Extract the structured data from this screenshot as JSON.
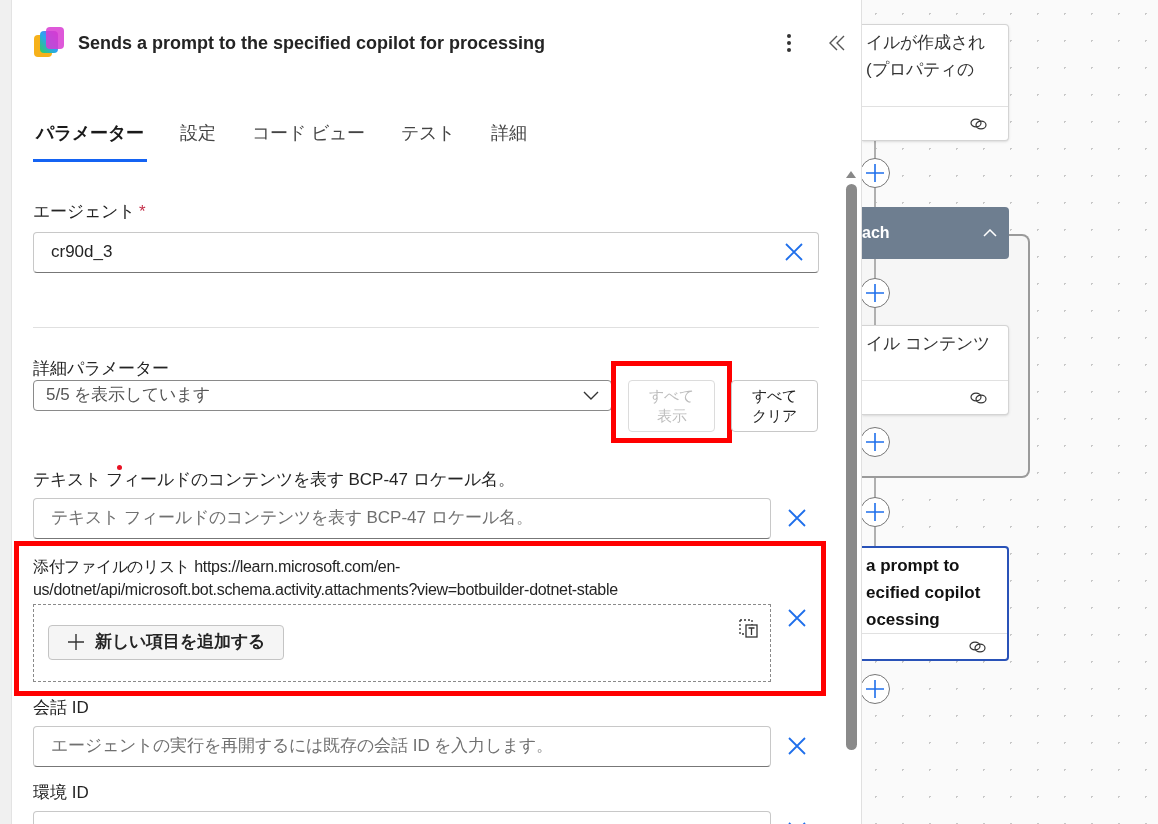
{
  "header": {
    "title": "Sends a prompt to the specified copilot for processing"
  },
  "tabs": [
    {
      "label": "パラメーター",
      "selected": true
    },
    {
      "label": "設定",
      "selected": false
    },
    {
      "label": "コード ビュー",
      "selected": false
    },
    {
      "label": "テスト",
      "selected": false
    },
    {
      "label": "詳細",
      "selected": false
    }
  ],
  "agent_field": {
    "label": "エージェント",
    "required_mark": "*",
    "value": "cr90d_3"
  },
  "advanced": {
    "label": "詳細パラメーター",
    "dropdown_value": "5/5 を表示しています",
    "buttons": [
      {
        "label": "すべて表示",
        "disabled": true,
        "highlighted": true
      },
      {
        "label": "すべてクリア",
        "disabled": false,
        "highlighted": false
      }
    ]
  },
  "parameters": [
    {
      "kind": "text",
      "label": "テキスト フィールドのコンテンツを表す BCP-47 ロケール名。",
      "placeholder": "テキスト フィールドのコンテンツを表す BCP-47 ロケール名。",
      "highlighted": false
    },
    {
      "kind": "array",
      "label": "添付ファイルのリスト https://learn.microsoft.com/en-us/dotnet/api/microsoft.bot.schema.activity.attachments?view=botbuilder-dotnet-stable",
      "add_button": "新しい項目を追加する",
      "highlighted": true
    },
    {
      "kind": "text",
      "label": "会話 ID",
      "placeholder": "エージェントの実行を再開するには既存の会話 ID を入力します。",
      "highlighted": false
    },
    {
      "kind": "text",
      "label": "環境 ID",
      "highlighted": false
    }
  ],
  "canvas": {
    "nodes": [
      {
        "kind": "action",
        "lines": [
          "イルが作成され",
          "(プロパティの"
        ],
        "selected": false
      },
      {
        "kind": "loop",
        "lines": [
          "ach"
        ]
      },
      {
        "kind": "action",
        "lines": [
          "イル コンテンツ"
        ],
        "selected": false
      },
      {
        "kind": "action",
        "lines": [
          "a prompt to",
          "ecified copilot",
          "ocessing"
        ],
        "selected": true
      }
    ]
  }
}
